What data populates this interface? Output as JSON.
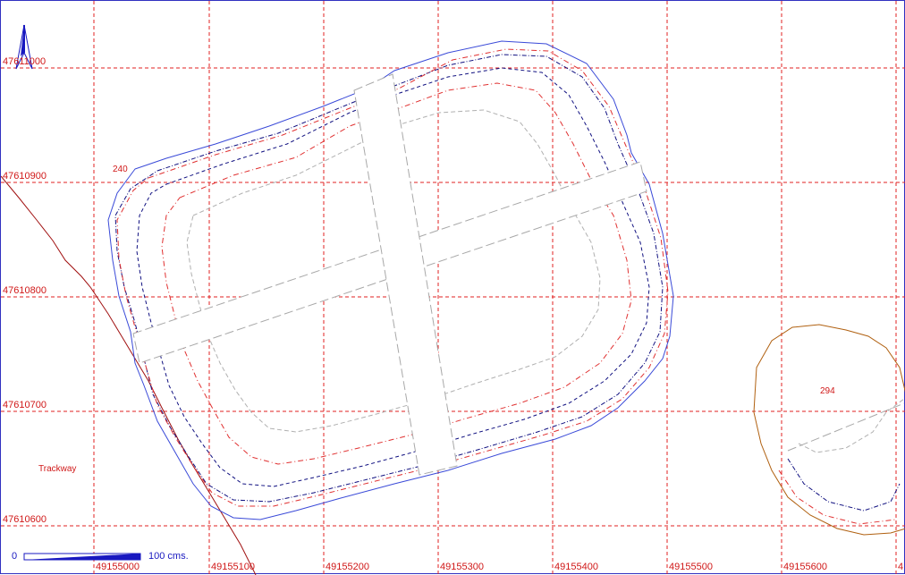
{
  "map": {
    "grid": {
      "eastings": [
        "49155000",
        "49155100",
        "49155200",
        "49155300",
        "49155400",
        "49155500",
        "49155600",
        "4"
      ],
      "northings": [
        "47611000",
        "47610900",
        "47610800",
        "47610700",
        "47610600"
      ]
    },
    "features": {
      "site_number": "240",
      "second_site_number": "294",
      "trackway_label": "Trackway"
    },
    "scale_bar": {
      "zero_label": "0",
      "length_label": "100 cms."
    },
    "north_arrow": {
      "icon": "north-arrow-icon"
    },
    "colors": {
      "grid": "#e02020",
      "outer_boundary": "#3a4ad8",
      "contour_navy": "#101080",
      "contour_red": "#e03030",
      "contour_grey": "#b0b0b0",
      "section_lines": "#a8a8a8",
      "trackway": "#a01010",
      "site_294": "#b06010"
    }
  }
}
